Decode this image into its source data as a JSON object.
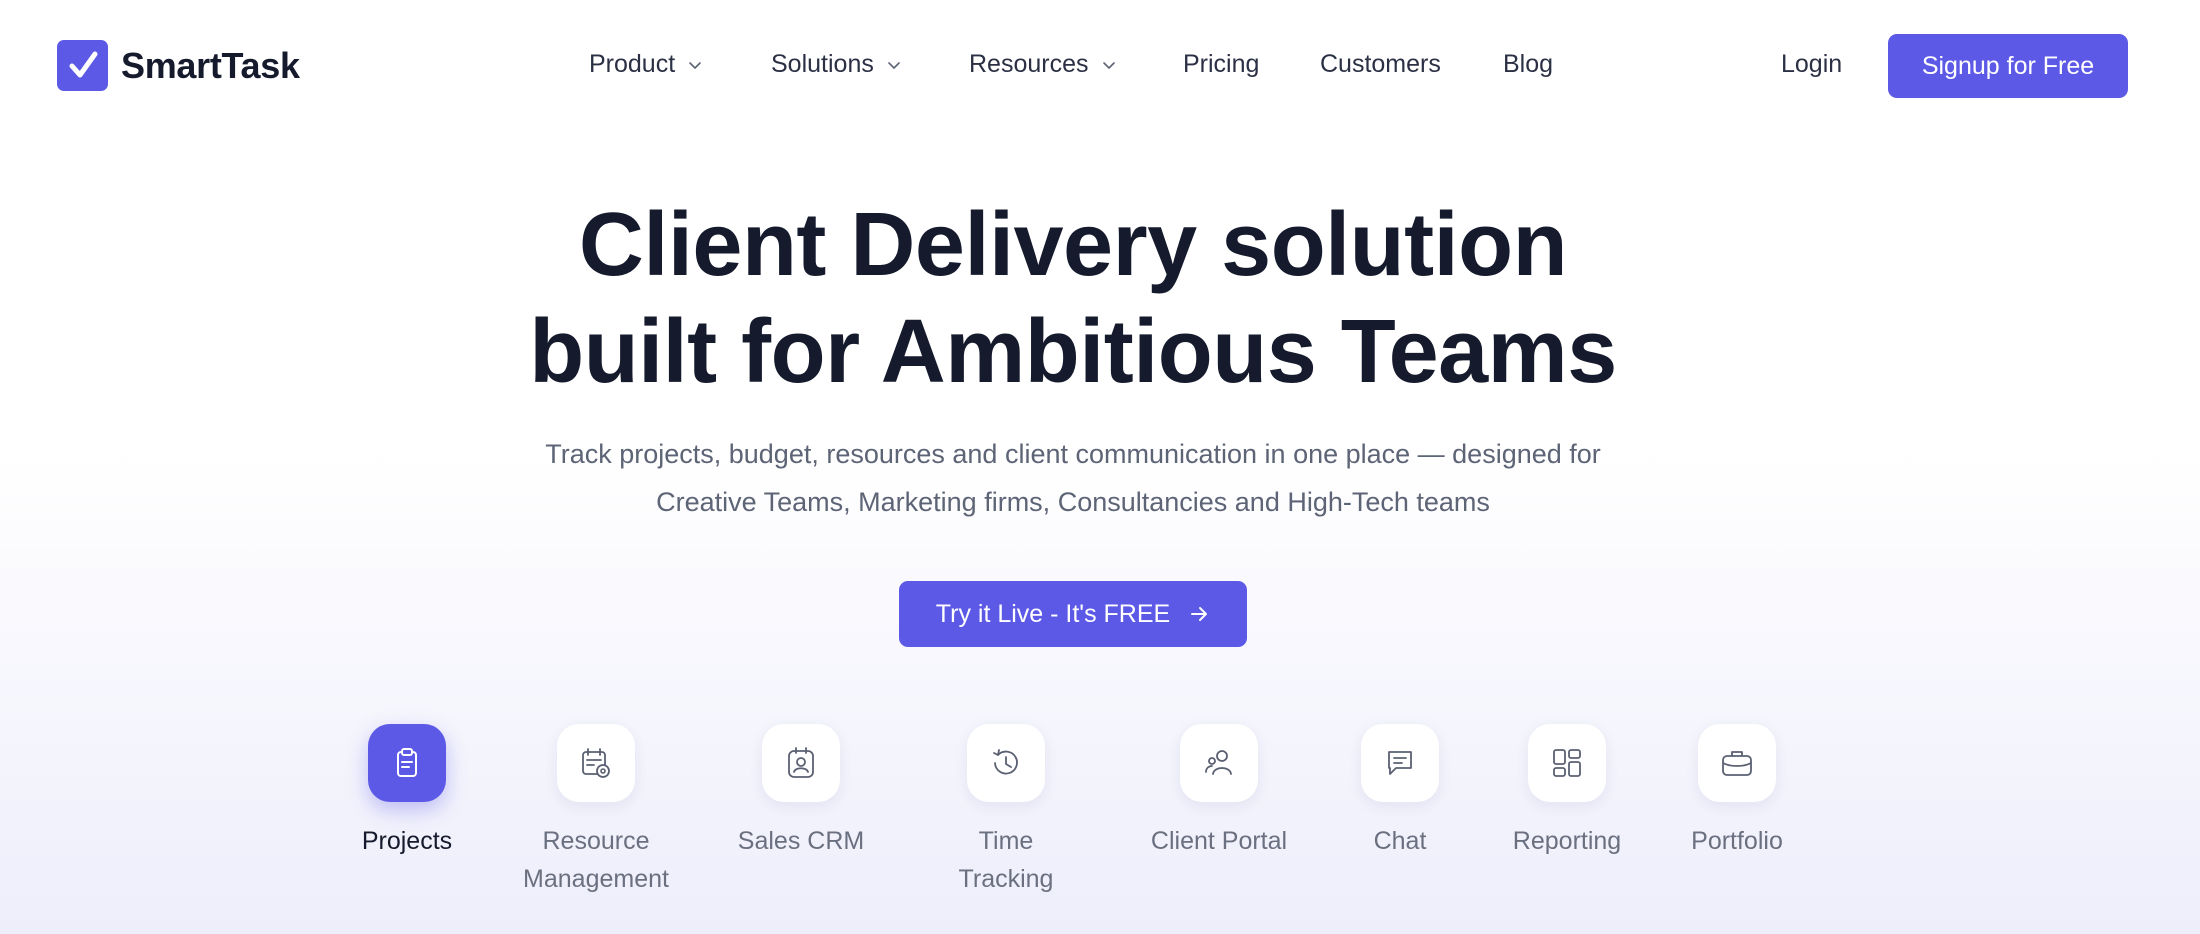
{
  "brand": {
    "name": "SmartTask",
    "accent": "#5c59e7"
  },
  "nav": {
    "items": [
      {
        "label": "Product",
        "has_dropdown": true
      },
      {
        "label": "Solutions",
        "has_dropdown": true
      },
      {
        "label": "Resources",
        "has_dropdown": true
      },
      {
        "label": "Pricing",
        "has_dropdown": false
      },
      {
        "label": "Customers",
        "has_dropdown": false
      },
      {
        "label": "Blog",
        "has_dropdown": false
      }
    ],
    "login": "Login",
    "signup": "Signup for Free"
  },
  "hero": {
    "title_line1": "Client Delivery solution",
    "title_line2": "built for Ambitious Teams",
    "subtitle_line1": "Track projects, budget, resources and client communication in one place — designed for",
    "subtitle_line2": "Creative Teams, Marketing firms, Consultancies and High-Tech teams",
    "cta": "Try it Live - It's FREE"
  },
  "features": [
    {
      "label_line1": "Projects",
      "label_line2": "",
      "icon": "clipboard-icon",
      "active": true
    },
    {
      "label_line1": "Resource",
      "label_line2": "Management",
      "icon": "calendar-gear-icon",
      "active": false
    },
    {
      "label_line1": "Sales CRM",
      "label_line2": "",
      "icon": "contact-card-icon",
      "active": false
    },
    {
      "label_line1": "Time",
      "label_line2": "Tracking",
      "icon": "clock-history-icon",
      "active": false
    },
    {
      "label_line1": "Client Portal",
      "label_line2": "",
      "icon": "users-icon",
      "active": false
    },
    {
      "label_line1": "Chat",
      "label_line2": "",
      "icon": "chat-bubble-icon",
      "active": false
    },
    {
      "label_line1": "Reporting",
      "label_line2": "",
      "icon": "dashboard-grid-icon",
      "active": false
    },
    {
      "label_line1": "Portfolio",
      "label_line2": "",
      "icon": "briefcase-icon",
      "active": false
    }
  ]
}
